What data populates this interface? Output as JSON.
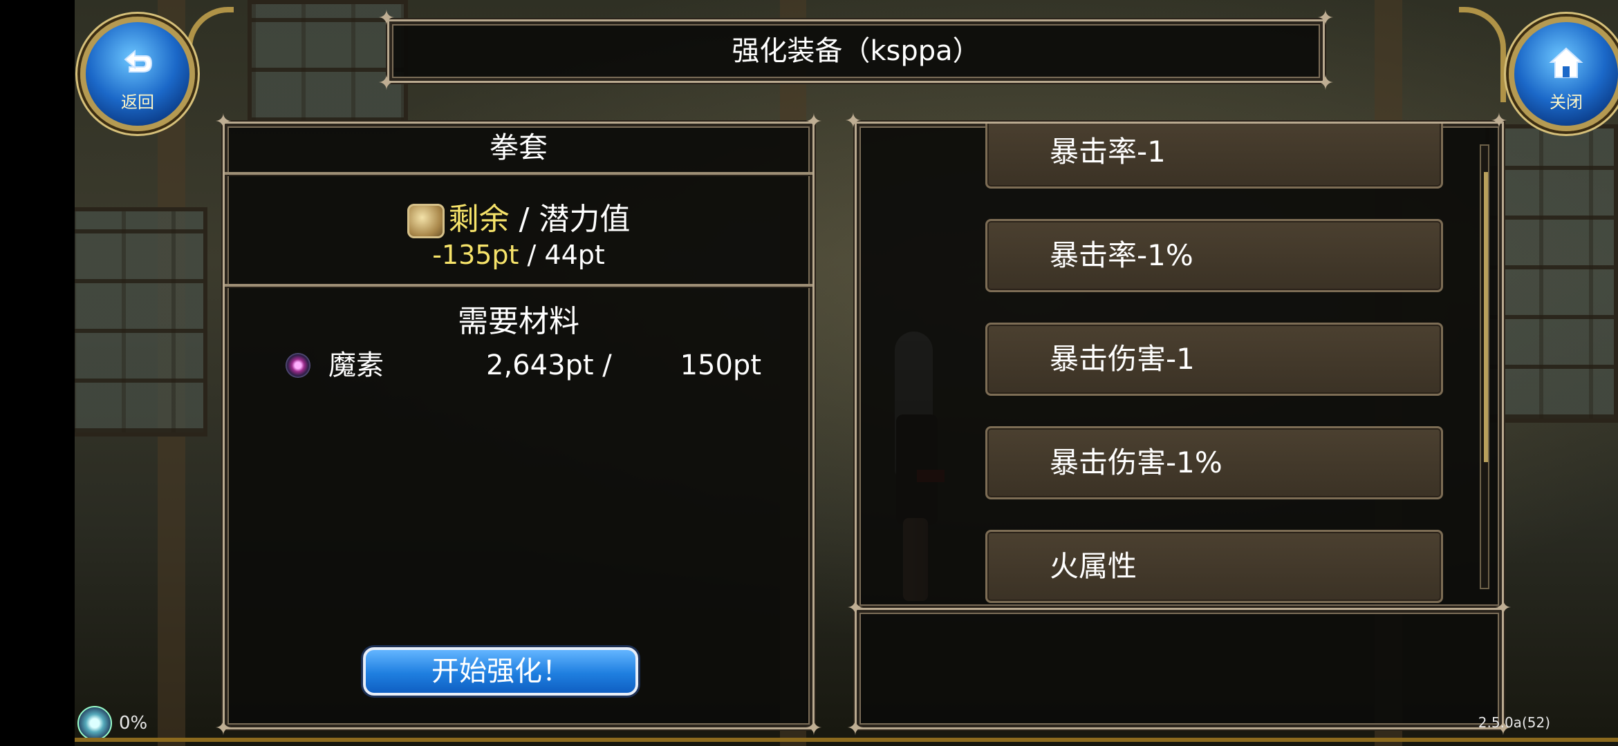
{
  "header": {
    "title": "强化装备（ksppa）",
    "back_label": "返回",
    "close_label": "关闭"
  },
  "left_panel": {
    "category": "拳套",
    "potential_remaining_label": "剩余",
    "potential_sep": " / ",
    "potential_value_label": "潜力值",
    "remaining_pt": "-135pt",
    "pt_sep": " / ",
    "potential_pt": "44pt",
    "materials_title": "需要材料",
    "material": {
      "icon": "mana-orb-icon",
      "name": "魔素",
      "have": "2,643pt /",
      "need": "150pt"
    },
    "start_button": "开始强化！"
  },
  "options": [
    "暴击率-1",
    "暴击率-1%",
    "暴击伤害-1",
    "暴击伤害-1%",
    "火属性"
  ],
  "status": {
    "percent": "0%",
    "version": "2.5.0a(52)"
  },
  "colors": {
    "highlight_yellow": "#f6e36a",
    "button_blue": "#1f7fe0",
    "panel_border": "#b9a98f"
  }
}
